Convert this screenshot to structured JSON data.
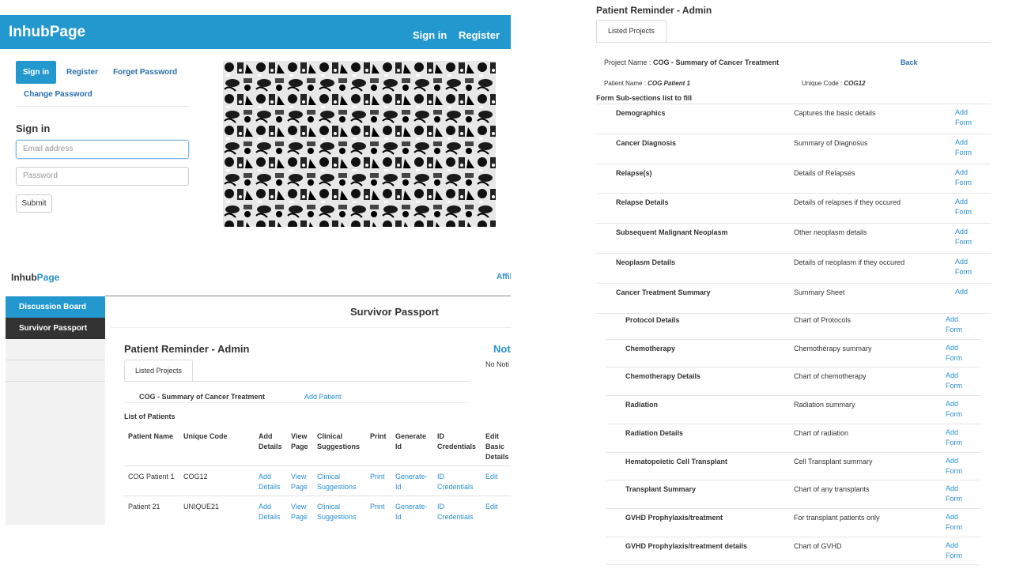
{
  "signin_panel": {
    "brand": "InhubPage",
    "nav": {
      "signin": "Sign in",
      "register": "Register"
    },
    "tabs": {
      "signin": "Sign in",
      "register": "Register",
      "forget": "Forget Password",
      "change": "Change Password"
    },
    "heading": "Sign in",
    "email_placeholder": "Email address",
    "password_placeholder": "Password",
    "submit_label": "Submit"
  },
  "passport_panel": {
    "brand_main": "Inhub",
    "brand_accent": "Page",
    "affil": "Affil",
    "sidebar": [
      "Discussion Board",
      "Survivor Passport"
    ],
    "page_title": "Survivor Passport",
    "section_title": "Patient Reminder - Admin",
    "notices_title": "Noti",
    "notices_sub": "No Noti",
    "tab": "Listed Projects",
    "project_name": "COG - Summary of Cancer Treatment",
    "add_patient": "Add Patient",
    "list_heading": "List of Patients",
    "headers": [
      "Patient Name",
      "Unique Code",
      "Add Details",
      "View Page",
      "Clinical Suggestions",
      "Print",
      "Generate Id",
      "ID Credentials",
      "Edit Basic Details"
    ],
    "rows": [
      {
        "name": "COG Patient 1",
        "code": "COG12",
        "add": "Add Details",
        "view": "View Page",
        "clinical": "Clinical Suggestions",
        "print": "Print",
        "generate": "Generate-Id",
        "credentials": "ID Credentials",
        "edit": "Edit"
      },
      {
        "name": "Patient 21",
        "code": "UNIQUE21",
        "add": "Add Details",
        "view": "View Page",
        "clinical": "Clinical Suggestions",
        "print": "Print",
        "generate": "Generate-Id",
        "credentials": "ID Credentials",
        "edit": "Edit"
      }
    ]
  },
  "forms_panel": {
    "title": "Patient Reminder - Admin",
    "tab": "Listed Projects",
    "project_label": "Project Name : ",
    "project_name": "COG - Summary of Cancer Treatment",
    "back": "Back",
    "patient_label": "Patient Name : ",
    "patient_name": "COG Patient 1",
    "unique_label": "Unique Code : ",
    "unique_code": "COG12",
    "form_heading": "Form Sub-sections list to fill",
    "sections": [
      {
        "name": "Demographics",
        "desc": "Captures the basic details",
        "action": "Add Form"
      },
      {
        "name": "Cancer Diagnosis",
        "desc": "Summary of Diagnosus",
        "action": "Add Form"
      },
      {
        "name": "Relapse(s)",
        "desc": "Details of Relapses",
        "action": "Add Form"
      },
      {
        "name": "Relapse Details",
        "desc": "Details of relapses if they occured",
        "action": "Add Form"
      },
      {
        "name": "Subsequent Malignant Neoplasm",
        "desc": "Other neoplasm details",
        "action": "Add Form"
      },
      {
        "name": "Neoplasm Details",
        "desc": "Details of neoplasm if they occured",
        "action": "Add Form"
      },
      {
        "name": "Cancer Treatment Summary",
        "desc": "Summary Sheet",
        "action": "Add"
      }
    ],
    "subsections": [
      {
        "name": "Protocol Details",
        "desc": "Chart of Protocols",
        "action": "Add Form"
      },
      {
        "name": "Chemotherapy",
        "desc": "Chemotherapy summary",
        "action": "Add Form"
      },
      {
        "name": "Chemotherapy Details",
        "desc": "Chart of chemotherapy",
        "action": "Add Form"
      },
      {
        "name": "Radiation",
        "desc": "Radiation summary",
        "action": "Add Form"
      },
      {
        "name": "Radiation Details",
        "desc": "Chart of radiation",
        "action": "Add Form"
      },
      {
        "name": "Hematopoietic Cell Transplant",
        "desc": "Cell Transplant summary",
        "action": "Add Form"
      },
      {
        "name": "Transplant Summary",
        "desc": "Chart of any transplants",
        "action": "Add Form"
      },
      {
        "name": "GVHD Prophylaxis/treatment",
        "desc": "For transplant patients only",
        "action": "Add Form"
      },
      {
        "name": "GVHD Prophylaxis/treatment details",
        "desc": "Chart of GVHD",
        "action": "Add Form"
      }
    ]
  },
  "colors": {
    "brand_blue": "#2398cf",
    "link_blue": "#2a8fd0",
    "dark": "#333333"
  }
}
